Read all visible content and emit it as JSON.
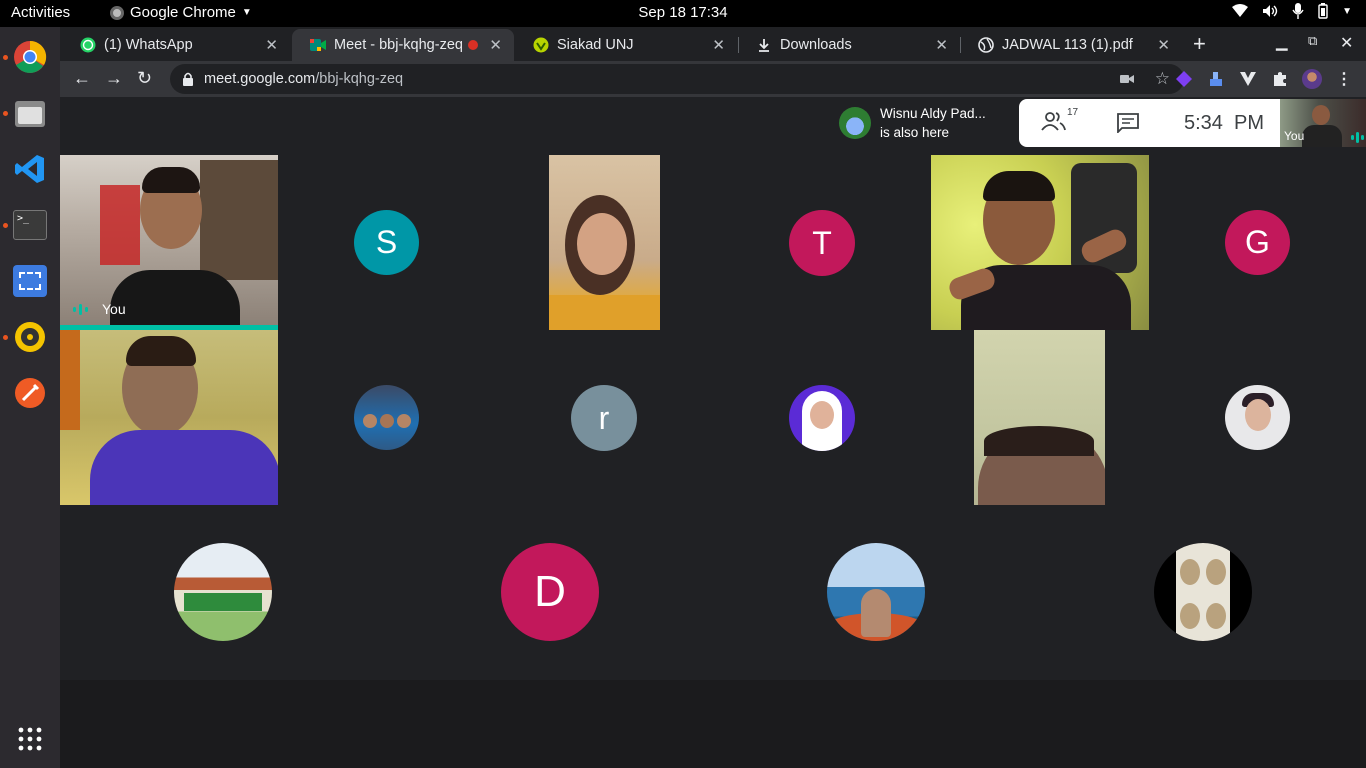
{
  "system": {
    "activities": "Activities",
    "app_name": "Google Chrome",
    "datetime": "Sep 18  17:34"
  },
  "tabs": [
    {
      "title": "(1) WhatsApp"
    },
    {
      "title": "Meet - bbj-kqhg-zeq"
    },
    {
      "title": "Siakad UNJ"
    },
    {
      "title": "Downloads"
    },
    {
      "title": "JADWAL 113 (1).pdf"
    }
  ],
  "address": {
    "host": "meet.google.com",
    "path": "/bbj-kqhg-zeq"
  },
  "meet": {
    "notification": {
      "name": "Wisnu Aldy Pad...",
      "text": "is also here"
    },
    "participants_count": "17",
    "time": "5:34  PM",
    "self_label": "You",
    "you_label": "You",
    "initials": {
      "s": "S",
      "t": "T",
      "g": "G",
      "r": "r",
      "d": "D"
    }
  },
  "colors": {
    "accent_teal": "#00bfa5",
    "avatar_teal": "#0097a7",
    "avatar_pink": "#c2185b",
    "avatar_grey": "#78909c"
  }
}
